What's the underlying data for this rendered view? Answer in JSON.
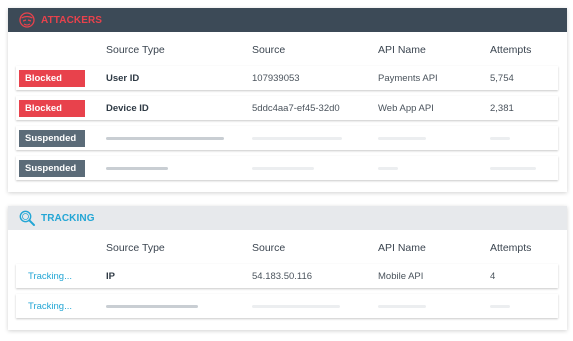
{
  "attackers": {
    "title": "ATTACKERS",
    "icon": "hacker-mask-icon",
    "accent": "#e8424c",
    "columns": [
      "Source Type",
      "Source",
      "API Name",
      "Attempts"
    ],
    "rows": [
      {
        "status": "Blocked",
        "source_type": "User ID",
        "source": "107939053",
        "api_name": "Payments API",
        "attempts": "5,754"
      },
      {
        "status": "Blocked",
        "source_type": "Device ID",
        "source": "5ddc4aa7-ef45-32d0",
        "api_name": "Web App API",
        "attempts": "2,381"
      },
      {
        "status": "Suspended"
      },
      {
        "status": "Suspended"
      }
    ]
  },
  "tracking": {
    "title": "TRACKING",
    "icon": "magnifier-icon",
    "accent": "#23a6d5",
    "columns": [
      "Source Type",
      "Source",
      "API Name",
      "Attempts"
    ],
    "rows": [
      {
        "status": "Tracking...",
        "source_type": "IP",
        "source": "54.183.50.116",
        "api_name": "Mobile API",
        "attempts": "4"
      },
      {
        "status": "Tracking..."
      }
    ]
  }
}
